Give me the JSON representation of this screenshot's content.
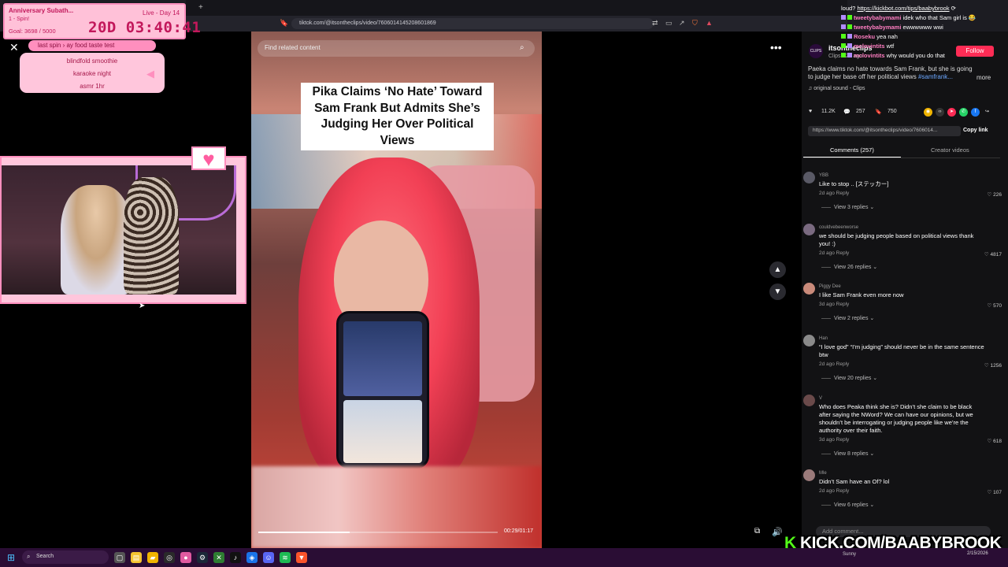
{
  "browser": {
    "url": "tiktok.com/@itsontheclips/video/7606014145208601869"
  },
  "stream_overlay": {
    "title": "Anniversary Subath...",
    "subtitle": "1 - Spin!",
    "goal": "Goal: 3698 / 5000",
    "live": "Live - Day 14",
    "timer": "20D 03:40:41",
    "spin_pill": "last spin  ›  ay food taste test",
    "spin_items": [
      "blindfold smoothie",
      "karaoke night",
      "asmr 1hr"
    ]
  },
  "video": {
    "search_placeholder": "Find related content",
    "caption": "Pika Claims ‘No Hate’ Toward Sam Frank But Admits She’s Judging Her Over Political Views",
    "timecode": "00:29/01:17",
    "progress": 0.38
  },
  "author": {
    "avatar_text": "CLIPS",
    "name": "itsontheclips",
    "sub": "Clips · 2d ago",
    "follow_label": "Follow",
    "description": "Paeka claims no hate towards Sam Frank, but she is going to judge her base off her political views ",
    "description_tag": "#samfrank...",
    "more_label": "more",
    "sound": "♫  original sound - Clips"
  },
  "stats": {
    "likes": "11.2K",
    "comments": "257",
    "saves": "750"
  },
  "link": {
    "url": "https://www.tiktok.com/@itsontheclips/video/7606014...",
    "copy_label": "Copy link"
  },
  "tabs": {
    "comments": "Comments (257)",
    "creator": "Creator videos"
  },
  "comments": [
    {
      "user": "YBB",
      "text": "Like to stop .. [ステッカー]",
      "meta": "2d ago   Reply",
      "likes": "♡ 226",
      "replies": "View 3 replies ⌄",
      "avatar": "#5a5a66"
    },
    {
      "user": "couldvebeenworse",
      "text": "we should be judging people based on political views thank you! :)",
      "meta": "2d ago   Reply",
      "likes": "♡ 4817",
      "replies": "View 26 replies ⌄",
      "avatar": "#7a6a80"
    },
    {
      "user": "Piggy Dee",
      "text": "I like Sam Frank even more now",
      "meta": "3d ago   Reply",
      "likes": "♡ 570",
      "replies": "View 2 replies ⌄",
      "avatar": "#c98a7a"
    },
    {
      "user": "Han",
      "text": "“I love god” “I’m judging” should never be in the same sentence btw",
      "meta": "2d ago   Reply",
      "likes": "♡ 1256",
      "replies": "View 20 replies ⌄",
      "avatar": "#8a8a8a"
    },
    {
      "user": "V",
      "text": "Who does Peaka think she is? Didn’t she claim to be black after saying the NWord? We can have our opinions, but we shouldn’t be interrogating or judging people like we’re the authority over their faith.",
      "meta": "3d ago   Reply",
      "likes": "♡ 618",
      "replies": "View 8 replies ⌄",
      "avatar": "#6a4a4a"
    },
    {
      "user": "Mle",
      "text": "Didn’t Sam have an Of? lol",
      "meta": "2d ago   Reply",
      "likes": "♡ 107",
      "replies": "View 6 replies ⌄",
      "avatar": "#9a7a7a"
    }
  ],
  "add_comment_placeholder": "Add comment...",
  "chat": [
    {
      "user": "",
      "text": "loud? ",
      "link": "https://kickbot.com/tips/baabybrook",
      "suffix": " ⟳"
    },
    {
      "user": "tweetybabymami",
      "text": " idek who that Sam girl is 😂",
      "link": "",
      "suffix": ""
    },
    {
      "user": "tweetybabymami",
      "text": " ewwwwww wwi",
      "link": "",
      "suffix": ""
    },
    {
      "user": "Roseku",
      "text": " yea nah",
      "link": "",
      "suffix": ""
    },
    {
      "user": "mclovintits",
      "text": " wtf",
      "link": "",
      "suffix": ""
    },
    {
      "user": "mclovintits",
      "text": " why would you do that",
      "link": "",
      "suffix": ""
    }
  ],
  "kick_banner": {
    "k": "K",
    "text": "KICK.COM/BAABYBROOK"
  },
  "taskbar": {
    "search": "Search",
    "clock_time": "",
    "clock_date": "2/15/2026",
    "weather": "Sunny"
  },
  "colors": {
    "tiktok_red": "#fe2c55",
    "overlay_pink": "#ffc1d8",
    "overlay_text": "#c2185b",
    "kick_green": "#53fc18"
  }
}
